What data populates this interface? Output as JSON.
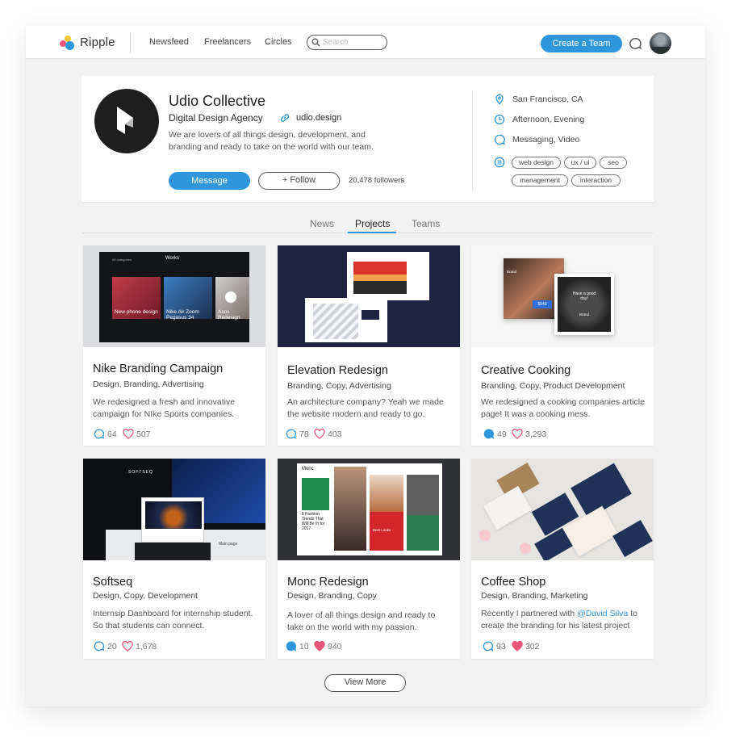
{
  "app": {
    "name": "Ripple"
  },
  "nav": {
    "items": [
      "Newsfeed",
      "Freelancers",
      "Circles"
    ]
  },
  "search": {
    "placeholder": "Search",
    "value": ""
  },
  "header": {
    "create_team_label": "Create a Team"
  },
  "profile": {
    "name": "Udio Collective",
    "subtitle": "Digital Design Agency",
    "website": "udio.design",
    "description": "We are lovers of all things design, development, and branding and ready to take on the world with our team.",
    "message_label": "Message",
    "follow_label": "+ Follow",
    "followers": "20,478 followers",
    "location": "San Francisco, CA",
    "availability": "Afternoon, Evening",
    "contact": "Messaging, Video",
    "tags": [
      "web design",
      "ux / ui",
      "seo",
      "management",
      "interaction"
    ]
  },
  "tabs": [
    {
      "label": "News",
      "active": false
    },
    {
      "label": "Projects",
      "active": true
    },
    {
      "label": "Teams",
      "active": false
    }
  ],
  "projects": [
    {
      "title": "Nike Branding Campaign",
      "tags": "Design, Branding, Advertising",
      "desc": "We redesigned a fresh and innovative campaign for NIke Sports companies.",
      "comments": "64",
      "likes": "507",
      "thumb": {
        "header": "Works",
        "menu": "All categories",
        "items": [
          "New phone design",
          "Nike Air Zoom Pegasus 34",
          "Asos Redesign"
        ]
      }
    },
    {
      "title": "Elevation Redesign",
      "tags": "Branding, Copy, Advertising",
      "desc": "An architecture company? Yeah we made the website modern and ready to go.",
      "comments": "78",
      "likes": "403"
    },
    {
      "title": "Creative Cooking",
      "tags": "Branding, Copy, Product Development",
      "desc": "We redesigned a cooking companies article page! It was a cooking mess.",
      "comments": "49",
      "likes": "3,293",
      "thumb": {
        "left_label": "Brand",
        "price": "$549",
        "right_label": "Have a good day!",
        "right_sub": "Brand"
      }
    },
    {
      "title": "Softseq",
      "tags": "Design, Copy, Development",
      "desc": "Internsip Dashboard for internship student. So that students can connect.",
      "comments": "20",
      "likes": "1,678",
      "thumb": {
        "logo": "SOFTSEQ",
        "caption": "Main page"
      }
    },
    {
      "title": "Monc Redesign",
      "tags": "Design, Branding, Copy",
      "desc": "A lover of all things design and ready to take on the world with my passion.",
      "comments": "10",
      "likes": "940",
      "thumb": {
        "logo": "Monc",
        "headline": "5 Fashion Trends That Will Be In for 2017",
        "promo": "Best Looks"
      }
    },
    {
      "title": "Coffee Shop",
      "tags": "Design, Branding, Marketing",
      "desc_before": "Recently I partnered with ",
      "desc_mention": "@David Silva",
      "desc_after": " to create the branding for his latest project",
      "comments": "93",
      "likes": "302"
    }
  ],
  "view_more_label": "View More",
  "colors": {
    "accent": "#2e97dc",
    "like": "#e8577a",
    "background": "#f2f2f3"
  },
  "icons": {
    "logo": "ripple-dots-logo",
    "search": "search-icon",
    "notifications": "chat-bubble-icon",
    "location": "location-pin-icon",
    "time": "clock-icon",
    "contact": "chat-bubble-icon",
    "tags": "list-icon",
    "comment": "comment-icon",
    "like": "heart-icon",
    "link": "link-icon"
  }
}
